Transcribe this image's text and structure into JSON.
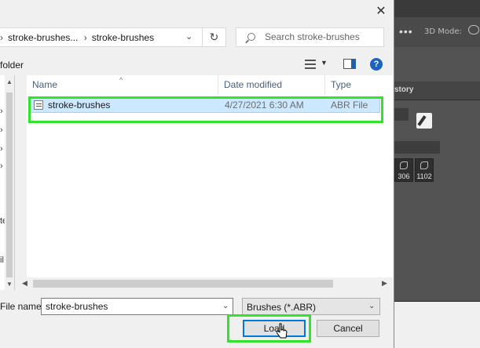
{
  "dialog": {
    "close_glyph": "✕",
    "address": {
      "segments": [
        "stroke-brushes...",
        "stroke-brushes"
      ],
      "separator": "›",
      "dropdown_glyph": "⌄",
      "refresh_glyph": "↻"
    },
    "search": {
      "placeholder": "Search stroke-brushes"
    },
    "toolbar": {
      "new_folder_label": "folder",
      "view_dropdown_glyph": "▼",
      "help_glyph": "?"
    },
    "nav_pane": {
      "clipped_labels": [
        "te",
        "il"
      ],
      "arrows": [
        "›",
        "›",
        "›",
        "›"
      ],
      "scroll_up": "▲",
      "scroll_down": "▼"
    },
    "file_list": {
      "columns": [
        "Name",
        "Date modified",
        "Type"
      ],
      "sort_glyph": "^",
      "rows": [
        {
          "name": "stroke-brushes",
          "date_modified": "4/27/2021 6:30 AM",
          "type": "ABR File",
          "selected": true
        }
      ],
      "hscroll_left": "◀",
      "hscroll_right": "▶"
    },
    "file_name": {
      "label": "File name:",
      "value": "stroke-brushes",
      "dropdown_glyph": "⌄"
    },
    "file_type": {
      "selected": "Brushes (*.ABR)",
      "dropdown_glyph": "⌄"
    },
    "buttons": {
      "load": "Load",
      "cancel": "Cancel"
    }
  },
  "background_app": {
    "more_glyph": "•••",
    "mode_label": "3D Mode:",
    "panel_tab": "story",
    "brush_thumbs": [
      "306",
      "1102"
    ]
  },
  "colors": {
    "highlight": "#33e22a",
    "selection": "#cce8ff",
    "accent": "#0078d7",
    "app_dark": "#535353"
  }
}
